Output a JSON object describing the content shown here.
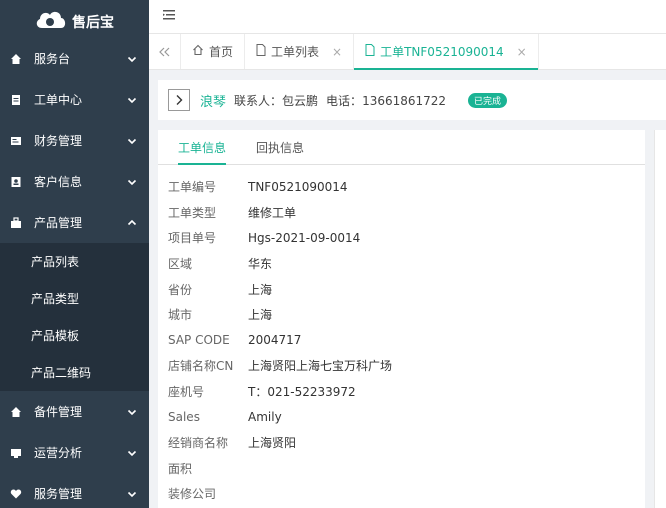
{
  "app": {
    "logo_text": "售后宝"
  },
  "sidebar": {
    "items": [
      {
        "label": "服务台",
        "icon": "home-icon",
        "expanded": false
      },
      {
        "label": "工单中心",
        "icon": "document-icon",
        "expanded": false
      },
      {
        "label": "财务管理",
        "icon": "finance-icon",
        "expanded": false
      },
      {
        "label": "客户信息",
        "icon": "customer-icon",
        "expanded": false
      },
      {
        "label": "产品管理",
        "icon": "product-icon",
        "expanded": true
      }
    ],
    "submenu": [
      "产品列表",
      "产品类型",
      "产品模板",
      "产品二维码"
    ],
    "items_after": [
      {
        "label": "备件管理",
        "icon": "home-icon"
      },
      {
        "label": "运营分析",
        "icon": "chart-icon"
      },
      {
        "label": "服务管理",
        "icon": "heart-icon"
      }
    ]
  },
  "tabs": [
    {
      "label": "首页",
      "icon": "home-outline-icon"
    },
    {
      "label": "工单列表",
      "icon": "file-icon",
      "close": "×"
    },
    {
      "label": "工单TNF0521090014",
      "icon": "file-icon",
      "close": "×",
      "active": true
    }
  ],
  "infobar": {
    "customer": "浪琴",
    "contact_label": "联系人：",
    "contact": "包云鹏",
    "phone_label": "电话：",
    "phone": "13661861722",
    "status": "已完成"
  },
  "subtabs": [
    "工单信息",
    "回执信息"
  ],
  "fields": [
    {
      "k": "工单编号",
      "v": "TNF0521090014"
    },
    {
      "k": "工单类型",
      "v": "维修工单"
    },
    {
      "k": "项目单号",
      "v": "Hgs-2021-09-0014"
    },
    {
      "k": "区域",
      "v": "华东"
    },
    {
      "k": "省份",
      "v": "上海"
    },
    {
      "k": "城市",
      "v": "上海"
    },
    {
      "k": "SAP CODE",
      "v": "2004717"
    },
    {
      "k": "店铺名称CN",
      "v": "上海贤阳上海七宝万科广场"
    },
    {
      "k": "座机号",
      "v": "T：021-52233972"
    },
    {
      "k": "Sales",
      "v": "Amily"
    },
    {
      "k": "经销商名称",
      "v": "上海贤阳"
    },
    {
      "k": "面积",
      "v": ""
    },
    {
      "k": "装修公司",
      "v": ""
    }
  ],
  "colors": {
    "accent": "#1ab394",
    "sidebar_bg": "#2f3e4c",
    "submenu_bg": "#24303c"
  }
}
